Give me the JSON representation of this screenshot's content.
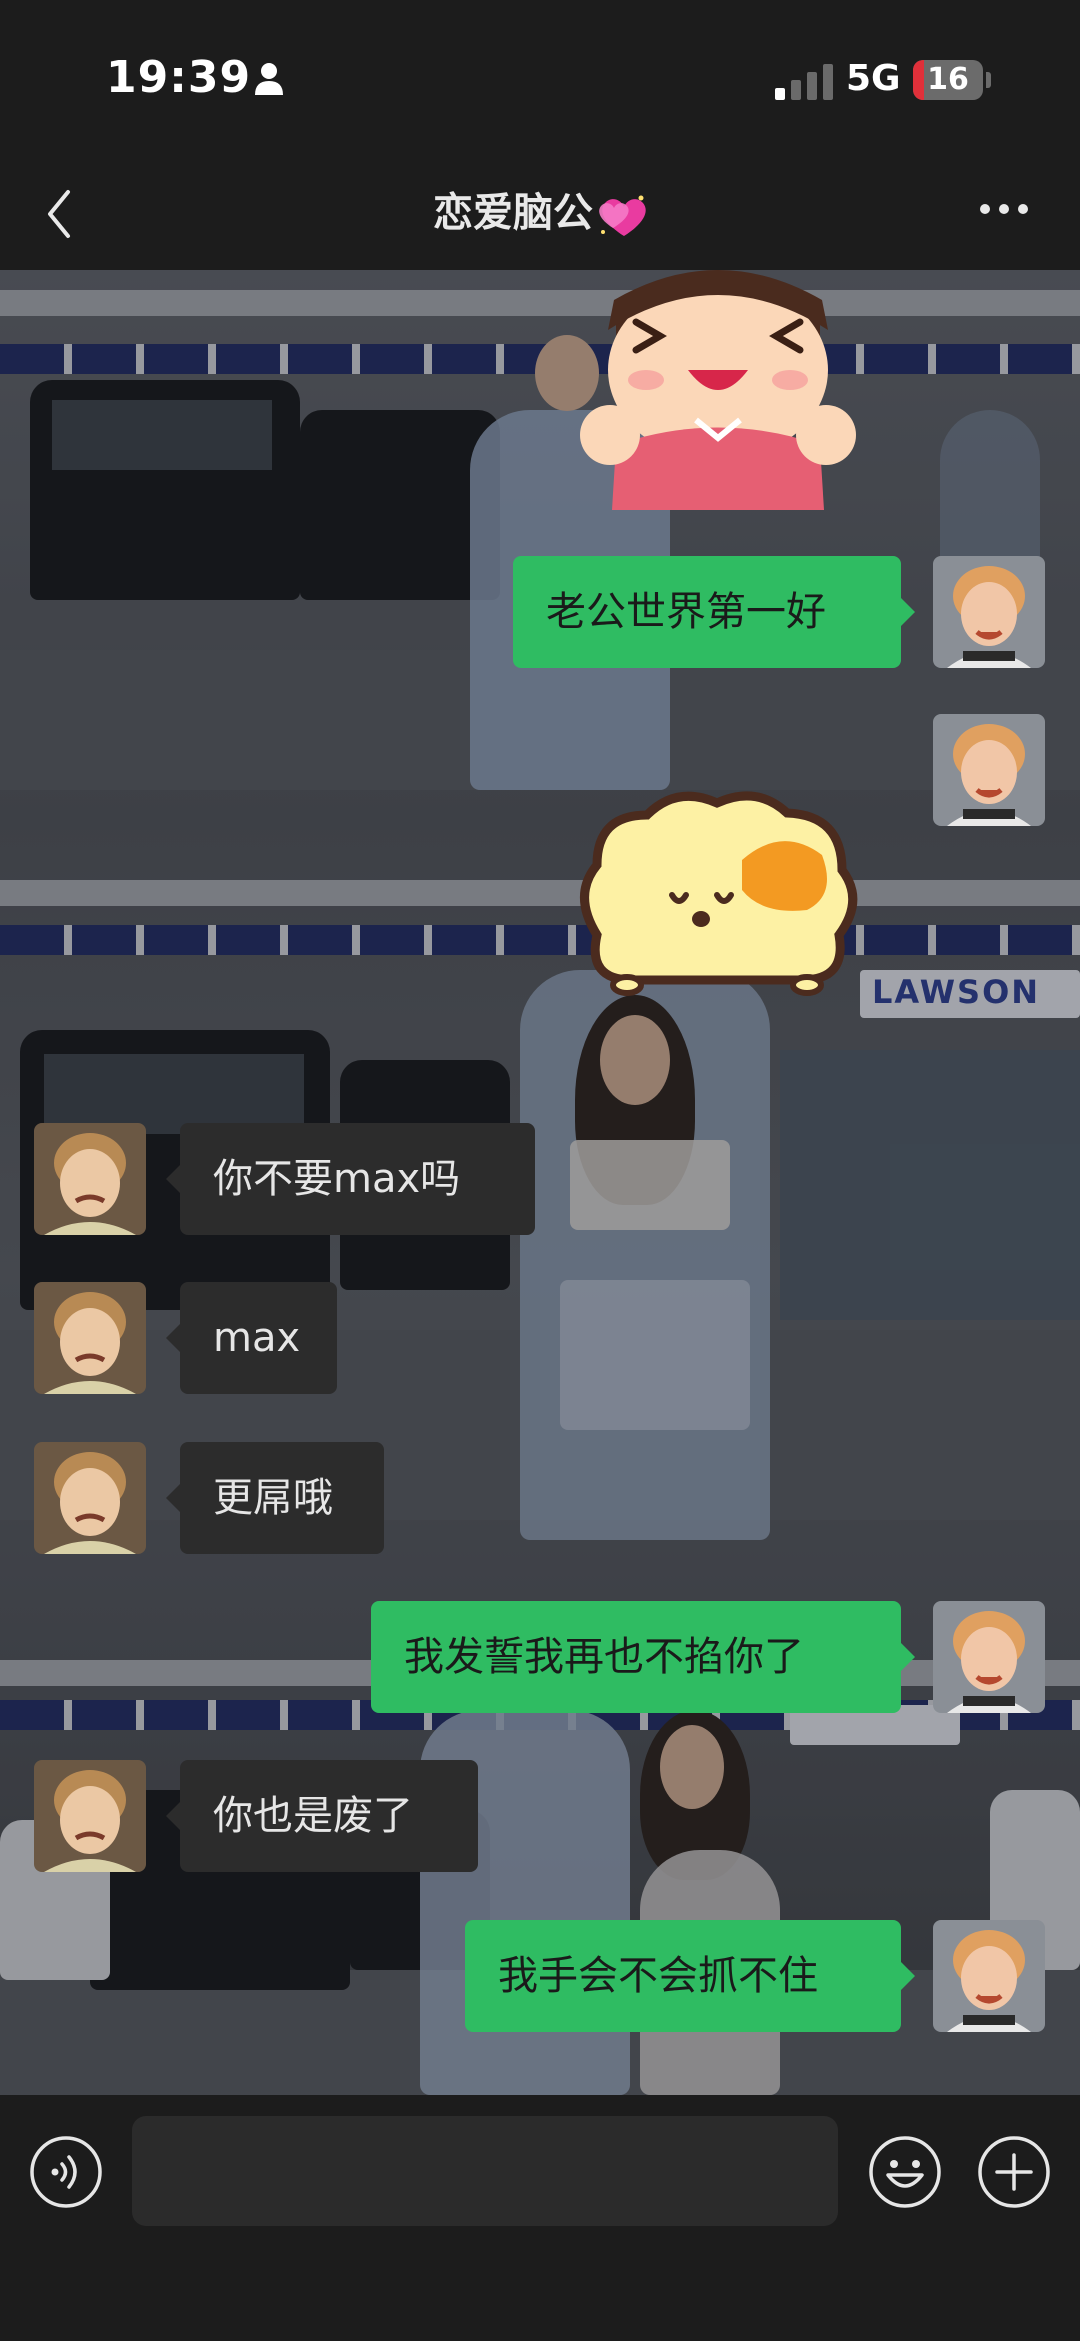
{
  "status_bar": {
    "time": "19:39",
    "network": "5G",
    "battery": 16,
    "battery_label": "16",
    "battery_color": "#e0303a"
  },
  "header": {
    "title": "恋爱脑公",
    "title_emoji_icon": "sparkling-heart-icon",
    "back_icon": "chevron-left-icon",
    "more_icon": "more-horizontal-icon"
  },
  "messages": [
    {
      "type": "sticker",
      "sender": "me",
      "icon": "cheering-girl-sticker"
    },
    {
      "type": "text",
      "sender": "me",
      "text": "老公世界第一好"
    },
    {
      "type": "sticker",
      "sender": "me",
      "icon": "yellow-blob-sticker"
    },
    {
      "type": "text",
      "sender": "other",
      "text": "你不要max吗"
    },
    {
      "type": "text",
      "sender": "other",
      "text": "max"
    },
    {
      "type": "text",
      "sender": "other",
      "text": "更屌哦"
    },
    {
      "type": "text",
      "sender": "me",
      "text": "我发誓我再也不掐你了"
    },
    {
      "type": "text",
      "sender": "other",
      "text": "你也是废了"
    },
    {
      "type": "text",
      "sender": "me",
      "text": "我手会不会抓不住"
    }
  ],
  "background_sign": "LAWSON",
  "input_bar": {
    "placeholder": "",
    "voice_icon": "voice-icon",
    "emoji_icon": "emoji-icon",
    "add_icon": "plus-icon"
  },
  "colors": {
    "bubble_out": "#2fbc62",
    "bubble_in": "#2c2c2c",
    "bar_background": "#1c1c1c"
  }
}
